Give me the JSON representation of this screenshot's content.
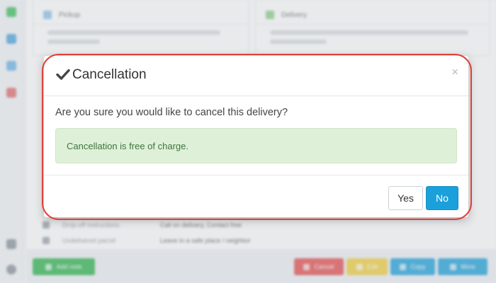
{
  "background": {
    "pickup_card": {
      "title": "Pickup"
    },
    "delivery_card": {
      "title": "Delivery"
    },
    "detail_rows": [
      {
        "label": "Drop-off instructions",
        "value": "Call on delivery, Contact free"
      },
      {
        "label": "Undelivered parcel",
        "value": "Leave in a safe place / neighbor"
      }
    ],
    "buttons": {
      "add": "Add note",
      "cancel": "Cancel",
      "edit": "Edit",
      "copy": "Copy",
      "more": "More"
    },
    "colors": {
      "green": "#2bb34a",
      "red": "#e74a4a",
      "yellow": "#f2cf3a",
      "blue": "#1aa0da"
    }
  },
  "modal": {
    "title": "Cancellation",
    "title_icon": "checkmark-icon",
    "close_symbol": "×",
    "message": "Are you sure you would like to cancel this delivery?",
    "alert": "Cancellation is free of charge.",
    "yes_label": "Yes",
    "no_label": "No",
    "accent": "#1aa0da",
    "alert_bg": "#dff0d8",
    "alert_text_color": "#3c763d",
    "highlight_color": "#e0413b"
  }
}
